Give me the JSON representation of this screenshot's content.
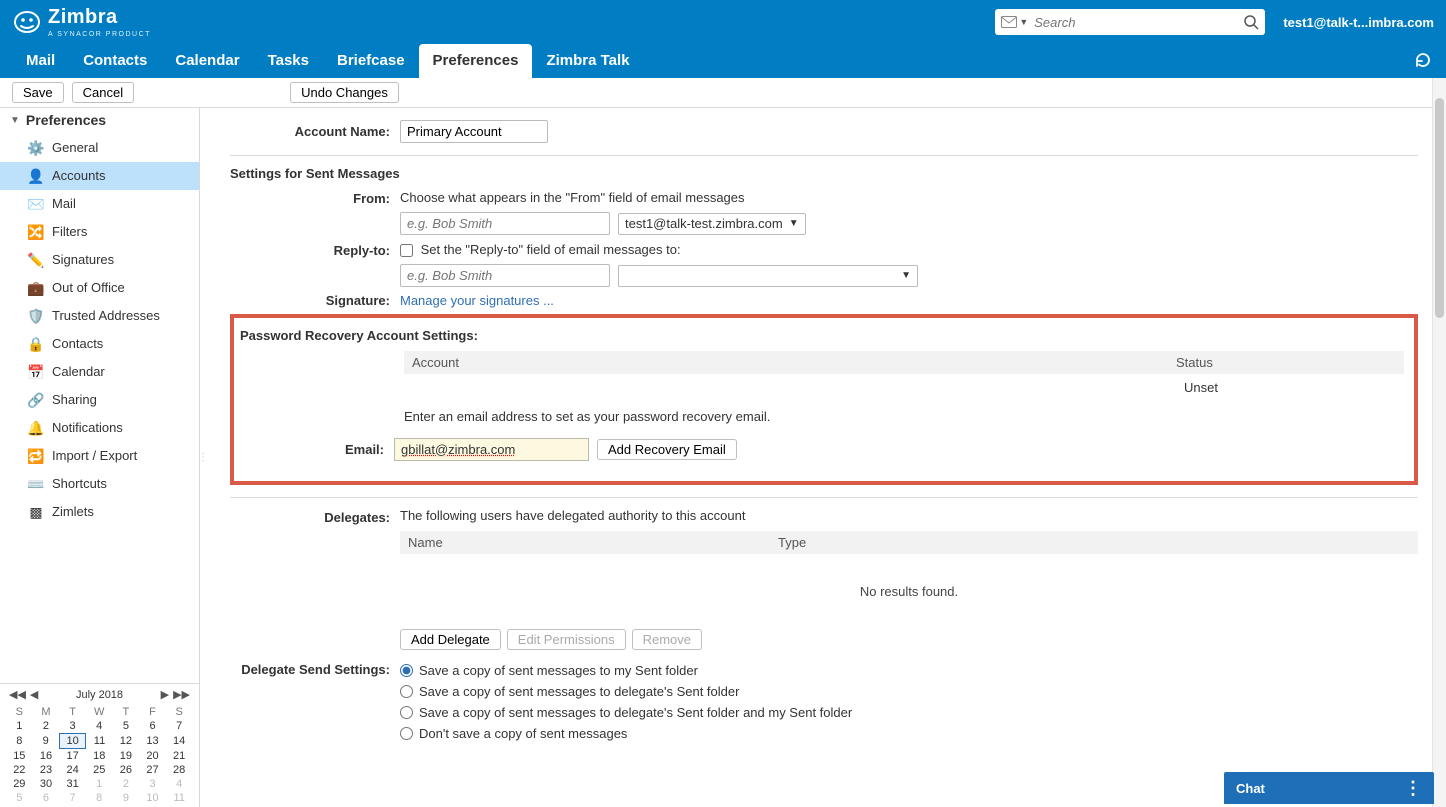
{
  "header": {
    "brand_main": "Zimbra",
    "brand_sub": "A SYNACOR PRODUCT",
    "search_placeholder": "Search",
    "user": "test1@talk-t...imbra.com",
    "search_dropdown_icon": "envelope-icon"
  },
  "tabs": {
    "items": [
      "Mail",
      "Contacts",
      "Calendar",
      "Tasks",
      "Briefcase",
      "Preferences",
      "Zimbra Talk"
    ],
    "active_index": 5
  },
  "toolbar": {
    "save": "Save",
    "cancel": "Cancel",
    "undo": "Undo Changes"
  },
  "sidebar": {
    "header": "Preferences",
    "items": [
      {
        "label": "General",
        "icon": "gear-icon"
      },
      {
        "label": "Accounts",
        "icon": "user-icon",
        "active": true
      },
      {
        "label": "Mail",
        "icon": "envelope-icon"
      },
      {
        "label": "Filters",
        "icon": "filter-icon"
      },
      {
        "label": "Signatures",
        "icon": "pen-icon"
      },
      {
        "label": "Out of Office",
        "icon": "briefcase-icon"
      },
      {
        "label": "Trusted Addresses",
        "icon": "shield-icon"
      },
      {
        "label": "Contacts",
        "icon": "contact-icon"
      },
      {
        "label": "Calendar",
        "icon": "calendar-icon"
      },
      {
        "label": "Sharing",
        "icon": "share-icon"
      },
      {
        "label": "Notifications",
        "icon": "bell-icon"
      },
      {
        "label": "Import / Export",
        "icon": "import-icon"
      },
      {
        "label": "Shortcuts",
        "icon": "keyboard-icon"
      },
      {
        "label": "Zimlets",
        "icon": "zimlet-icon"
      }
    ]
  },
  "content": {
    "account_name_label": "Account Name:",
    "account_name_value": "Primary Account",
    "sent_title": "Settings for Sent Messages",
    "from_label": "From:",
    "from_hint": "Choose what appears in the \"From\" field of email messages",
    "from_name_placeholder": "e.g. Bob Smith",
    "from_dropdown": "test1@talk-test.zimbra.com",
    "replyto_label": "Reply-to:",
    "replyto_hint": "Set the \"Reply-to\" field of email messages to:",
    "replyto_name_placeholder": "e.g. Bob Smith",
    "signature_label": "Signature:",
    "signature_link": "Manage your signatures ...",
    "pr_title": "Password Recovery Account Settings:",
    "pr_col_account": "Account",
    "pr_col_status": "Status",
    "pr_status_value": "Unset",
    "pr_msg": "Enter an email address to set as your password recovery email.",
    "pr_email_label": "Email:",
    "pr_email_value": "gbillat@zimbra.com",
    "pr_add_btn": "Add Recovery Email",
    "del_label": "Delegates:",
    "del_hint": "The following users have delegated authority to this account",
    "del_col_name": "Name",
    "del_col_type": "Type",
    "del_empty": "No results found.",
    "del_add": "Add Delegate",
    "del_edit": "Edit Permissions",
    "del_remove": "Remove",
    "dss_label": "Delegate Send Settings:",
    "dss_options": [
      "Save a copy of sent messages to my Sent folder",
      "Save a copy of sent messages to delegate's Sent folder",
      "Save a copy of sent messages to delegate's Sent folder and my Sent folder",
      "Don't save a copy of sent messages"
    ],
    "dss_selected": 0
  },
  "calendar": {
    "title": "July 2018",
    "dow": [
      "S",
      "M",
      "T",
      "W",
      "T",
      "F",
      "S"
    ],
    "today": 10,
    "weeks": [
      [
        {
          "d": 1
        },
        {
          "d": 2
        },
        {
          "d": 3
        },
        {
          "d": 4
        },
        {
          "d": 5
        },
        {
          "d": 6
        },
        {
          "d": 7
        }
      ],
      [
        {
          "d": 8
        },
        {
          "d": 9
        },
        {
          "d": 10
        },
        {
          "d": 11
        },
        {
          "d": 12
        },
        {
          "d": 13
        },
        {
          "d": 14
        }
      ],
      [
        {
          "d": 15
        },
        {
          "d": 16
        },
        {
          "d": 17
        },
        {
          "d": 18
        },
        {
          "d": 19
        },
        {
          "d": 20
        },
        {
          "d": 21
        }
      ],
      [
        {
          "d": 22
        },
        {
          "d": 23
        },
        {
          "d": 24
        },
        {
          "d": 25
        },
        {
          "d": 26
        },
        {
          "d": 27
        },
        {
          "d": 28
        }
      ],
      [
        {
          "d": 29
        },
        {
          "d": 30
        },
        {
          "d": 31
        },
        {
          "d": 1,
          "dim": true
        },
        {
          "d": 2,
          "dim": true
        },
        {
          "d": 3,
          "dim": true
        },
        {
          "d": 4,
          "dim": true
        }
      ],
      [
        {
          "d": 5,
          "dim": true
        },
        {
          "d": 6,
          "dim": true
        },
        {
          "d": 7,
          "dim": true
        },
        {
          "d": 8,
          "dim": true
        },
        {
          "d": 9,
          "dim": true
        },
        {
          "d": 10,
          "dim": true
        },
        {
          "d": 11,
          "dim": true
        }
      ]
    ]
  },
  "chat": {
    "label": "Chat"
  }
}
